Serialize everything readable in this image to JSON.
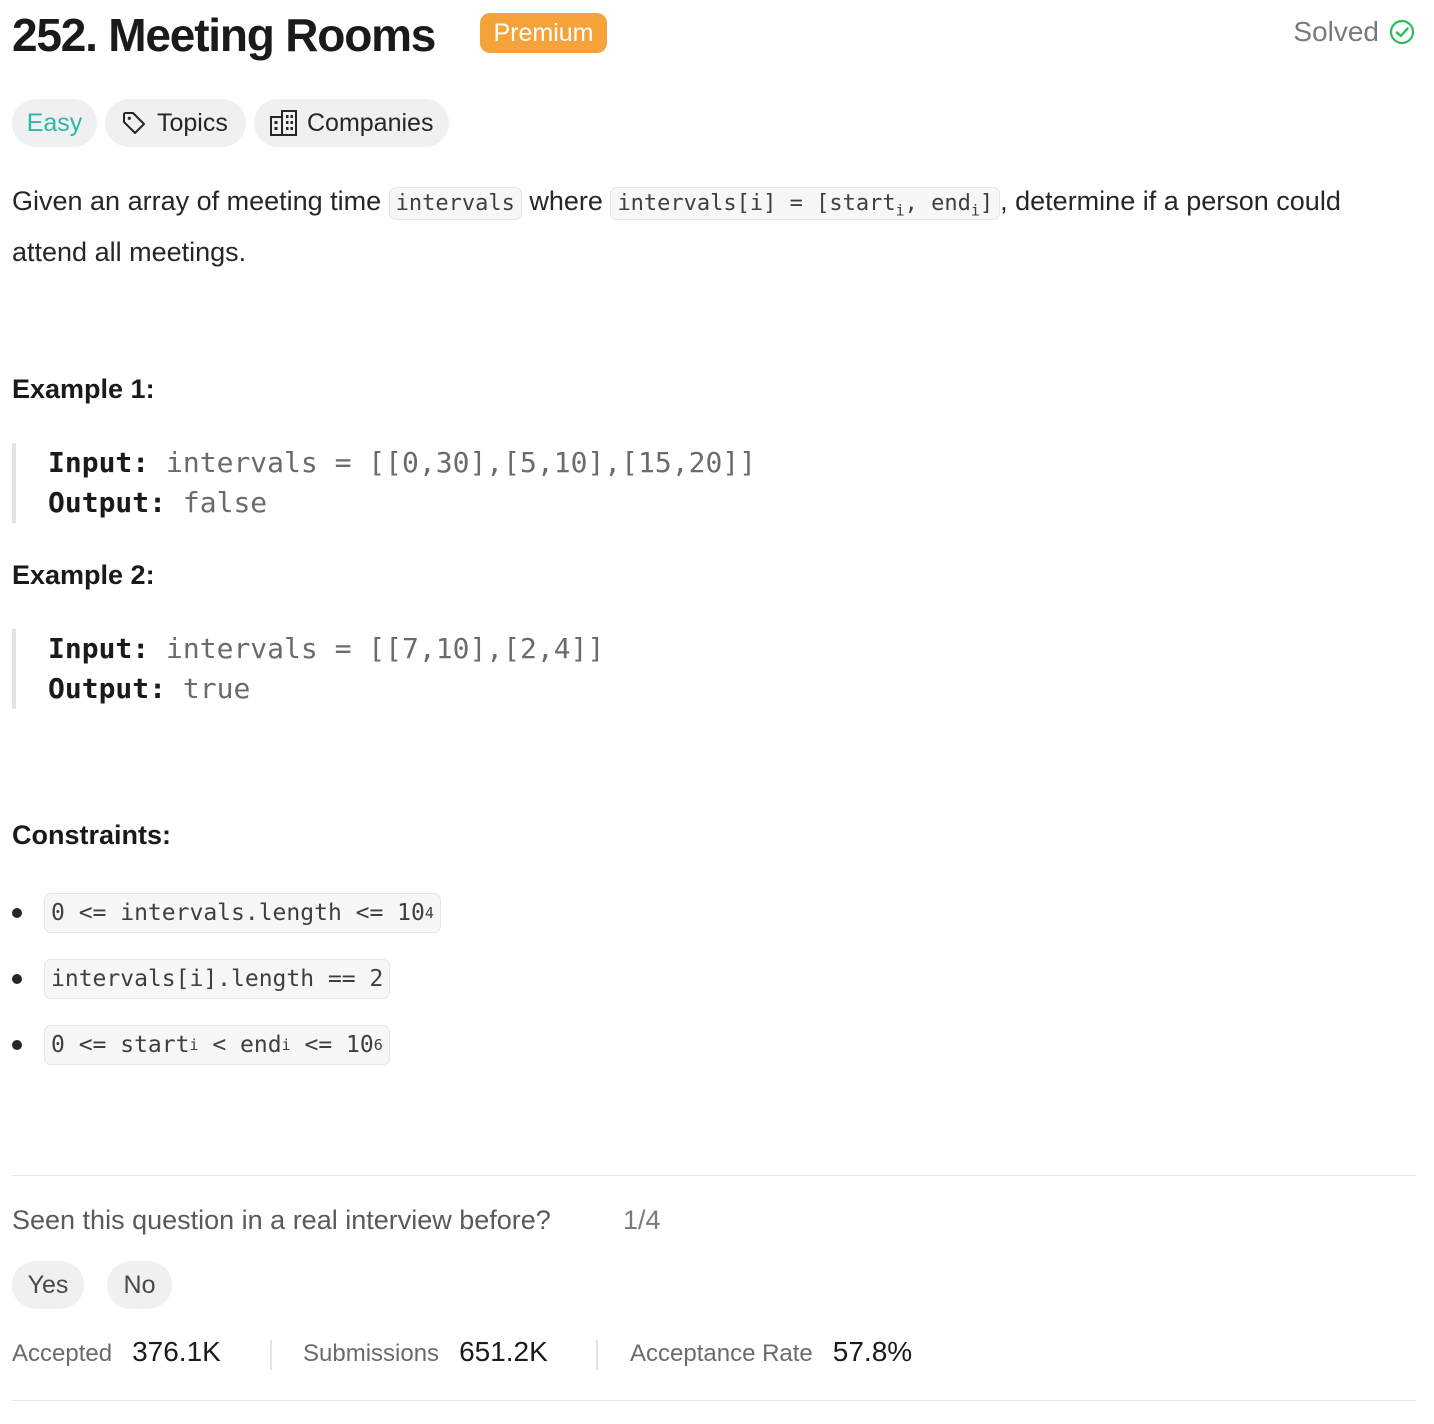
{
  "problem": {
    "title": "252. Meeting Rooms",
    "premium_badge": "Premium",
    "solved_label": "Solved",
    "difficulty": "Easy",
    "topics_label": "Topics",
    "companies_label": "Companies"
  },
  "description": {
    "part1": "Given an array of meeting time ",
    "code1": "intervals",
    "part2": " where ",
    "code2_a": "intervals[i] = [start",
    "code2_sub1": "i",
    "code2_b": ", end",
    "code2_sub2": "i",
    "code2_c": "]",
    "part3": ", determine if a person could attend all meetings."
  },
  "examples": [
    {
      "heading": "Example 1:",
      "input_label": "Input:",
      "input_value": "intervals = [[0,30],[5,10],[15,20]]",
      "output_label": "Output:",
      "output_value": "false"
    },
    {
      "heading": "Example 2:",
      "input_label": "Input:",
      "input_value": "intervals = [[7,10],[2,4]]",
      "output_label": "Output:",
      "output_value": "true"
    }
  ],
  "constraints": {
    "heading": "Constraints:",
    "c1_text": "0 <= intervals.length <= 10",
    "c1_sup": "4",
    "c2_text": "intervals[i].length == 2",
    "c3_a": "0 <= start",
    "c3_sub1": "i",
    "c3_b": " < end",
    "c3_sub2": "i",
    "c3_c": " <= 10",
    "c3_sup": "6"
  },
  "interview": {
    "question": "Seen this question in a real interview before?",
    "count": "1/4",
    "yes": "Yes",
    "no": "No"
  },
  "stats": {
    "accepted_label": "Accepted",
    "accepted_value": "376.1K",
    "submissions_label": "Submissions",
    "submissions_value": "651.2K",
    "rate_label": "Acceptance Rate",
    "rate_value": "57.8%"
  },
  "colors": {
    "premium": "#f5a23b",
    "easy": "#2db7a7",
    "solved_check": "#2cbb5d"
  }
}
